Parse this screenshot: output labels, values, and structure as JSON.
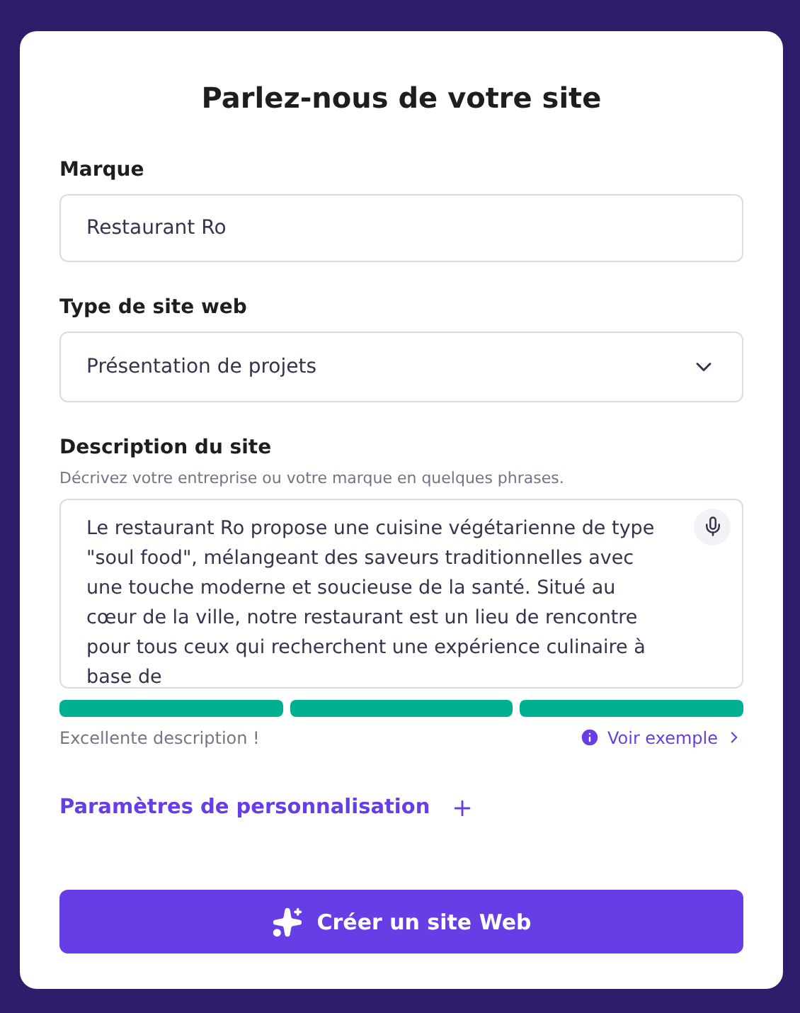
{
  "title": "Parlez-nous de votre site",
  "brand": {
    "label": "Marque",
    "value": "Restaurant Ro"
  },
  "site_type": {
    "label": "Type de site web",
    "value": "Présentation de projets"
  },
  "description": {
    "label": "Description du site",
    "hint": "Décrivez votre entreprise ou votre marque en quelques phrases.",
    "value": "Le restaurant Ro propose une cuisine végétarienne de type \"soul food\", mélangeant des saveurs traditionnelles avec une touche moderne et soucieuse de la santé. Situé au cœur de la ville, notre restaurant est un lieu de rencontre pour tous ceux qui recherchent une expérience culinaire à base de",
    "meter": [
      {
        "filled": true
      },
      {
        "filled": true
      },
      {
        "filled": true
      }
    ],
    "rating": "Excellente description !",
    "example_link": "Voir exemple"
  },
  "customization": {
    "label": "Paramètres de personnalisation",
    "expanded": false
  },
  "submit": "Créer un site Web"
}
